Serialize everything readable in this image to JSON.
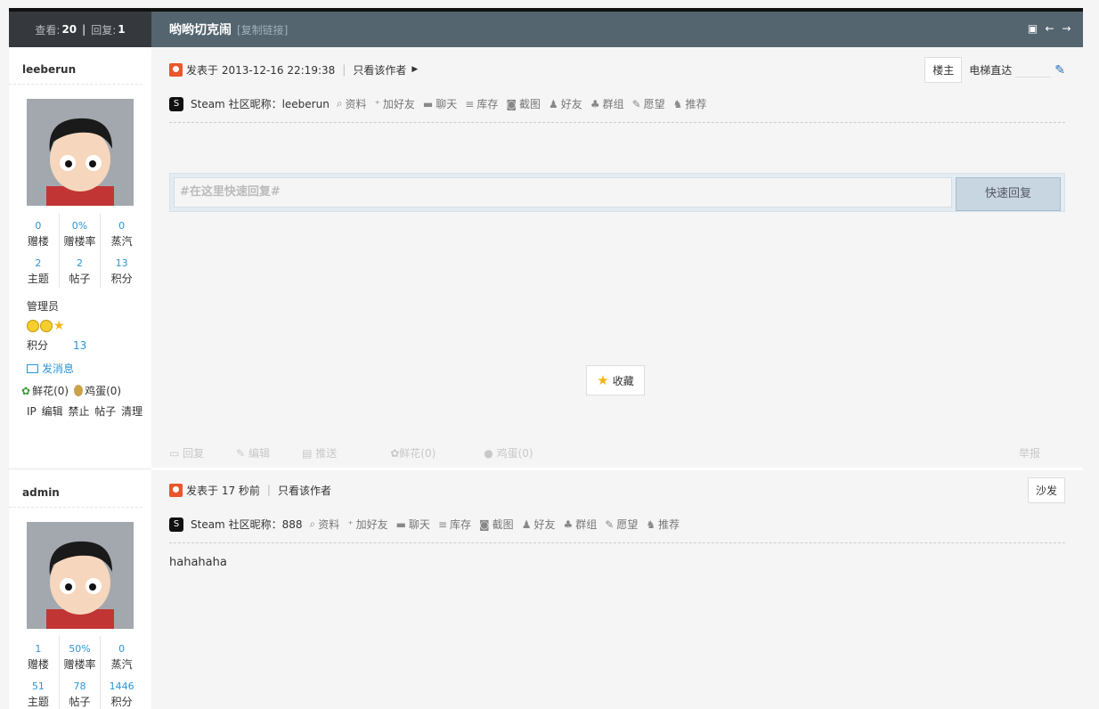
{
  "header": {
    "views_label": "查看:",
    "views": "20",
    "replies_label": "回复:",
    "replies": "1",
    "title": "哟哟切克闹",
    "copy_link": "[复制链接]"
  },
  "icons": [
    "print-icon",
    "prev-thread-icon",
    "next-thread-icon",
    "user-icon",
    "steam-icon",
    "search-icon",
    "add-friend-icon",
    "chat-icon",
    "inventory-icon",
    "screenshot-icon",
    "friends-icon",
    "group-icon",
    "wishlist-icon",
    "recommend-icon",
    "star-icon",
    "envelope-icon",
    "flower-icon",
    "egg-icon"
  ],
  "colors": {
    "accent": "#2a95d5",
    "header_bar": "#54656f",
    "header_dark": "#35393d",
    "user_icon": "#e9572b"
  },
  "posts": [
    {
      "user": {
        "name": "leeberun",
        "stats": [
          {
            "num": "0",
            "label": "赠楼"
          },
          {
            "num": "0%",
            "label": "赠楼率"
          },
          {
            "num": "0",
            "label": "蒸汽"
          },
          {
            "num": "2",
            "label": "主题"
          },
          {
            "num": "2",
            "label": "帖子"
          },
          {
            "num": "13",
            "label": "积分"
          }
        ],
        "group": "管理员",
        "points_label": "积分",
        "points": "13",
        "send_message": "发消息",
        "flowers": "鲜花(0)",
        "eggs": "鸡蛋(0)",
        "admin_links": [
          "IP",
          "编辑",
          "禁止",
          "帖子",
          "清理"
        ]
      },
      "posted": "发表于 2013-12-16 22:19:38",
      "only_author": "只看该作者",
      "floor": "楼主",
      "elevator": "电梯直达",
      "steam_nick": "Steam 社区昵称：leeberun",
      "steam_actions": [
        "资料",
        "加好友",
        "聊天",
        "库存",
        "截图",
        "好友",
        "群组",
        "愿望",
        "推荐"
      ],
      "quick_placeholder": "#在这里快速回复#",
      "quick_button": "快速回复",
      "favorite": "收藏",
      "actions": [
        "回复",
        "编辑",
        "推送",
        "鲜花(0)",
        "鸡蛋(0)"
      ],
      "report": "举报"
    },
    {
      "user": {
        "name": "admin",
        "stats": [
          {
            "num": "1",
            "label": "赠楼"
          },
          {
            "num": "50%",
            "label": "赠楼率"
          },
          {
            "num": "0",
            "label": "蒸汽"
          },
          {
            "num": "51",
            "label": "主题"
          },
          {
            "num": "78",
            "label": "帖子"
          },
          {
            "num": "1446",
            "label": "积分"
          }
        ]
      },
      "posted": "发表于 17 秒前",
      "only_author": "只看该作者",
      "floor": "沙发",
      "steam_nick": "Steam 社区昵称：888",
      "steam_actions": [
        "资料",
        "加好友",
        "聊天",
        "库存",
        "截图",
        "好友",
        "群组",
        "愿望",
        "推荐"
      ],
      "body": "hahahaha"
    }
  ]
}
